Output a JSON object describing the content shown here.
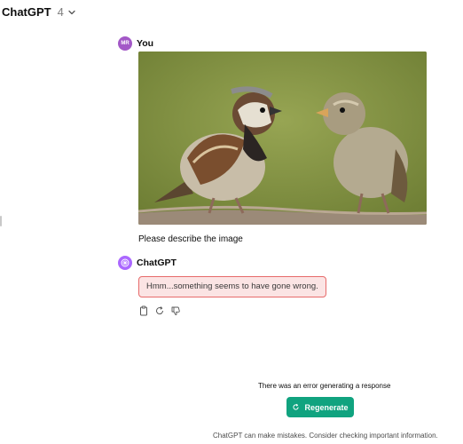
{
  "header": {
    "model_name": "ChatGPT",
    "model_version": "4",
    "chevron_icon": "chevron-down-icon"
  },
  "conversation": {
    "user": {
      "avatar_initials": "MR",
      "name": "You",
      "image_alt": "Two sparrows perched on a branch",
      "text": "Please describe the image"
    },
    "assistant": {
      "name": "ChatGPT",
      "error_message": "Hmm...something seems to have gone wrong.",
      "actions": [
        "clipboard-icon",
        "regenerate-icon",
        "thumbs-down-icon"
      ]
    }
  },
  "error_bar": {
    "text": "There was an error generating a response",
    "regenerate_label": "Regenerate"
  },
  "footer": {
    "disclaimer": "ChatGPT can make mistakes. Consider checking important information."
  },
  "colors": {
    "accent": "#10a37f",
    "error_border": "#e76b6b",
    "error_bg": "#fbe4e4",
    "user_avatar": "#a358c7",
    "assistant_avatar": "#ab68ff"
  }
}
